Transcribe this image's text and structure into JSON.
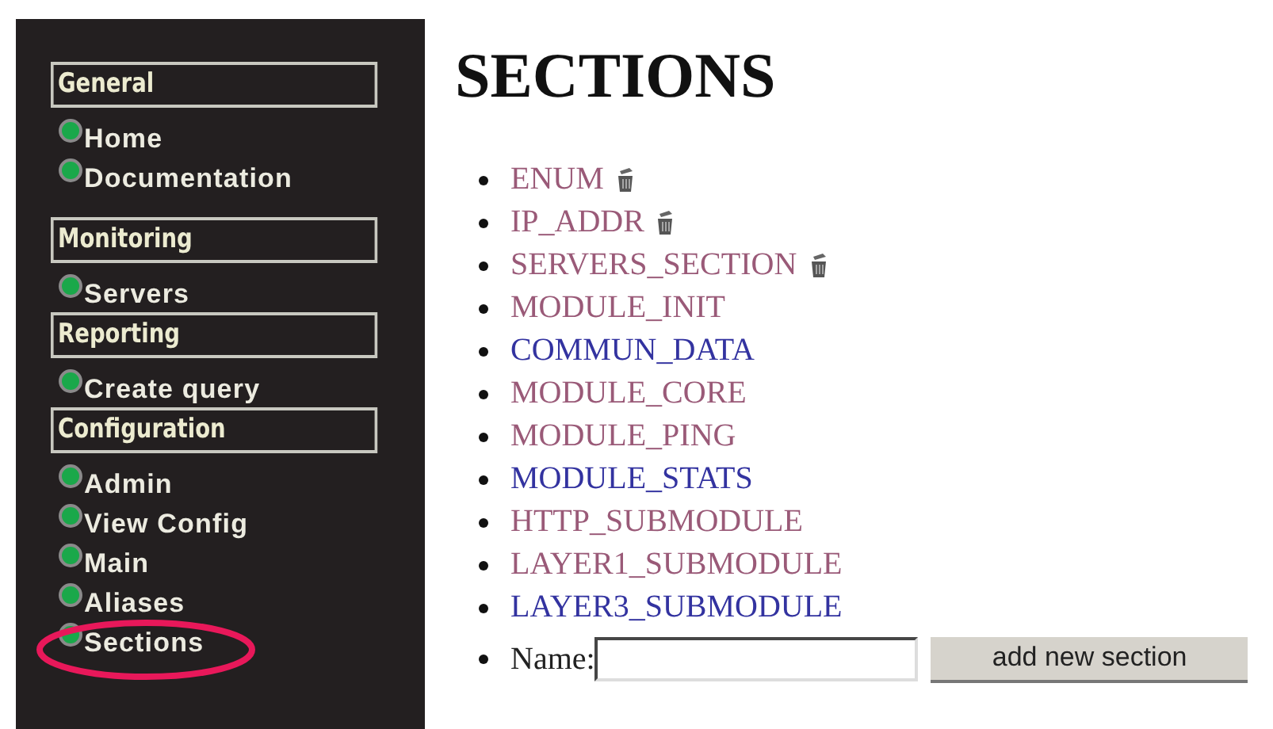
{
  "sidebar": {
    "groups": [
      {
        "title": "General",
        "items": [
          {
            "label": "Home",
            "circled": false
          },
          {
            "label": "Documentation",
            "circled": false
          }
        ]
      },
      {
        "title": "Monitoring",
        "items": [
          {
            "label": "Servers",
            "circled": false
          }
        ]
      },
      {
        "title": "Reporting",
        "items": [
          {
            "label": "Create query",
            "circled": false
          }
        ]
      },
      {
        "title": "Configuration",
        "items": [
          {
            "label": "Admin",
            "circled": false
          },
          {
            "label": "View Config",
            "circled": false
          },
          {
            "label": "Main",
            "circled": false
          },
          {
            "label": "Aliases",
            "circled": false
          },
          {
            "label": "Sections",
            "circled": true
          }
        ]
      }
    ]
  },
  "page": {
    "title": "SECTIONS",
    "sections": [
      {
        "label": "ENUM",
        "visited": true,
        "deletable": true
      },
      {
        "label": "IP_ADDR",
        "visited": true,
        "deletable": true
      },
      {
        "label": "SERVERS_SECTION",
        "visited": true,
        "deletable": true
      },
      {
        "label": "MODULE_INIT",
        "visited": true,
        "deletable": false
      },
      {
        "label": "COMMUN_DATA",
        "visited": false,
        "deletable": false
      },
      {
        "label": "MODULE_CORE",
        "visited": true,
        "deletable": false
      },
      {
        "label": "MODULE_PING",
        "visited": true,
        "deletable": false
      },
      {
        "label": "MODULE_STATS",
        "visited": false,
        "deletable": false
      },
      {
        "label": "HTTP_SUBMODULE",
        "visited": true,
        "deletable": false
      },
      {
        "label": "LAYER1_SUBMODULE",
        "visited": true,
        "deletable": false
      },
      {
        "label": "LAYER3_SUBMODULE",
        "visited": false,
        "deletable": false
      }
    ],
    "form": {
      "label": "Name:",
      "button": "add new section"
    }
  }
}
